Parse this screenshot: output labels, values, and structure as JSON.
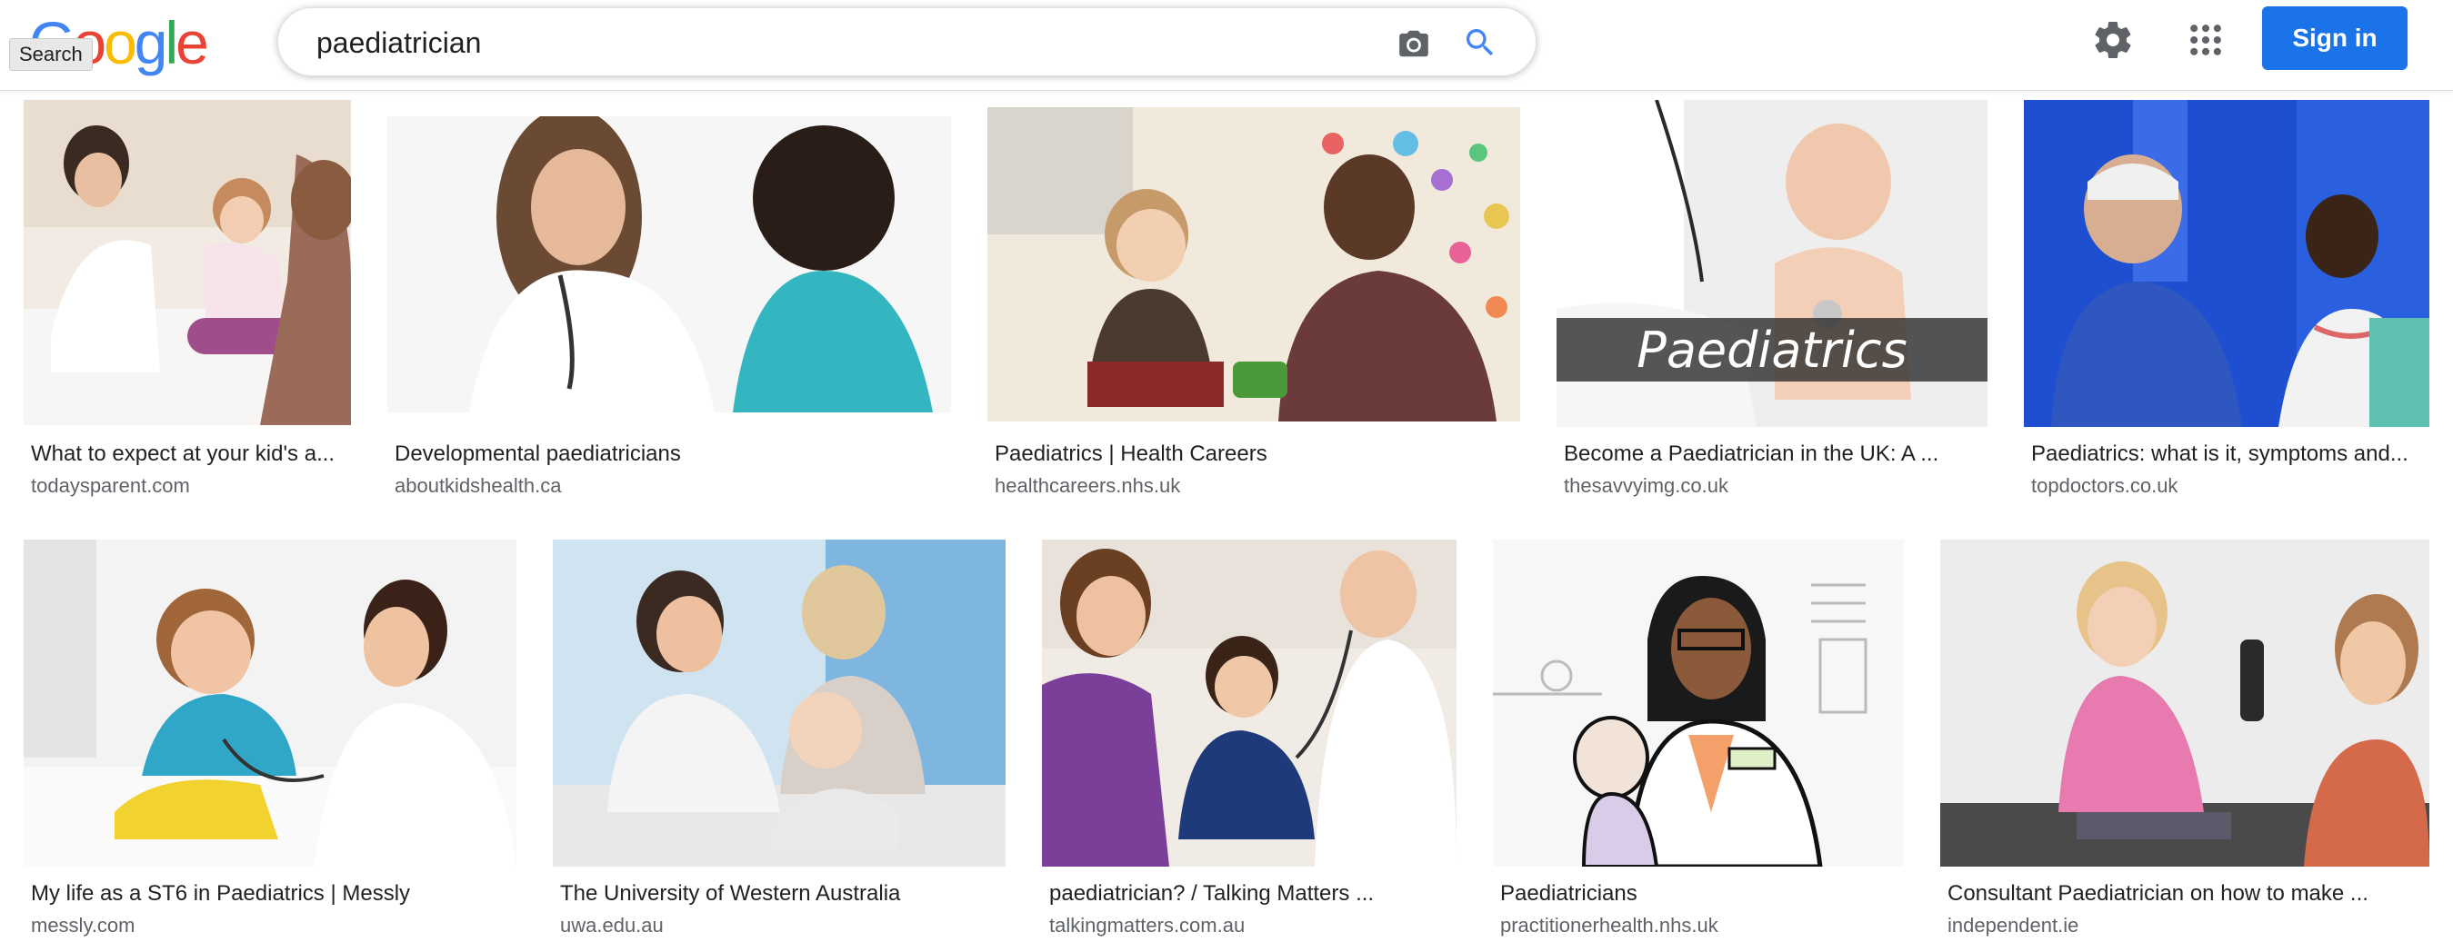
{
  "header": {
    "logo_letters": [
      "G",
      "o",
      "o",
      "g",
      "l",
      "e"
    ],
    "logo_colors": [
      "#4285F4",
      "#EA4335",
      "#FBBC05",
      "#4285F4",
      "#34A853",
      "#EA4335"
    ],
    "tooltip": "Search",
    "search_value": "paediatrician",
    "sign_in_label": "Sign in",
    "accent": "#1a73e8"
  },
  "icons": {
    "camera": "camera-icon",
    "search": "search-icon",
    "settings": "gear-icon",
    "apps": "apps-grid-icon"
  },
  "results": [
    {
      "title": "What to expect at your kid's a...",
      "source": "todaysparent.com"
    },
    {
      "title": "Developmental paediatricians",
      "source": "aboutkidshealth.ca"
    },
    {
      "title": "Paediatrics | Health Careers",
      "source": "healthcareers.nhs.uk"
    },
    {
      "title": "Become a Paediatrician in the UK: A ...",
      "source": "thesavvyimg.co.uk",
      "overlay": "Paediatrics"
    },
    {
      "title": "Paediatrics: what is it, symptoms and...",
      "source": "topdoctors.co.uk"
    },
    {
      "title": "My life as a ST6 in Paediatrics | Messly",
      "source": "messly.com"
    },
    {
      "title": "The University of Western Australia",
      "source": "uwa.edu.au"
    },
    {
      "title": "paediatrician? / Talking Matters ...",
      "source": "talkingmatters.com.au"
    },
    {
      "title": "Paediatricians",
      "source": "practitionerhealth.nhs.uk"
    },
    {
      "title": "Consultant Paediatrician on how to make ...",
      "source": "independent.ie"
    }
  ]
}
